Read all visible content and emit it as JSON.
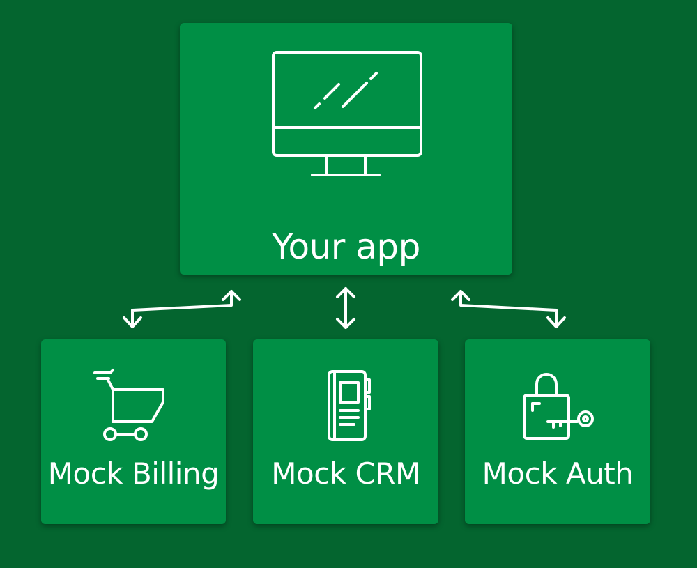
{
  "colors": {
    "background": "#04652f",
    "card": "#008f45",
    "foreground": "#ffffff"
  },
  "app": {
    "label": "Your app",
    "icon": "monitor-icon"
  },
  "services": [
    {
      "label": "Mock Billing",
      "icon": "shopping-cart-icon"
    },
    {
      "label": "Mock CRM",
      "icon": "address-book-icon"
    },
    {
      "label": "Mock Auth",
      "icon": "padlock-key-icon"
    }
  ],
  "connectors": [
    {
      "from": "Your app",
      "to": "Mock Billing",
      "direction": "bidirectional"
    },
    {
      "from": "Your app",
      "to": "Mock CRM",
      "direction": "bidirectional"
    },
    {
      "from": "Your app",
      "to": "Mock Auth",
      "direction": "bidirectional"
    }
  ]
}
